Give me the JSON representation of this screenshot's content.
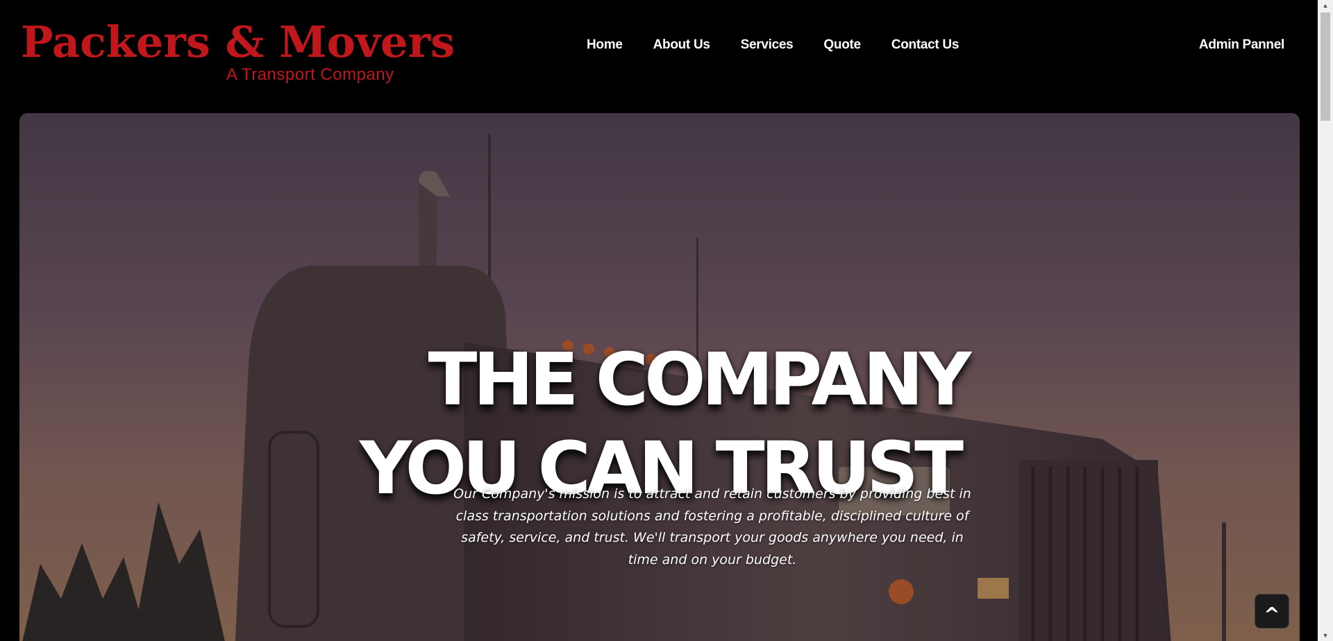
{
  "brand": {
    "title": "Packers & Movers",
    "subtitle": "A Transport Company",
    "color": "#c0171d"
  },
  "nav": {
    "items": [
      {
        "label": "Home"
      },
      {
        "label": "About Us"
      },
      {
        "label": "Services"
      },
      {
        "label": "Quote"
      },
      {
        "label": "Contact Us"
      }
    ],
    "admin_label": "Admin Pannel"
  },
  "hero": {
    "title_line1": "THE COMPANY",
    "title_line2": "YOU CAN TRUST",
    "description": "Our Company's mission is to attract and retain customers by providing best in class transportation solutions and fostering a profitable, disciplined culture of safety, service, and trust. We'll transport your goods anywhere you need, in time and on your budget."
  },
  "back_to_top": {
    "label": "^"
  },
  "scrollbar": {
    "up_icon": "▲",
    "down_icon": "▼"
  }
}
